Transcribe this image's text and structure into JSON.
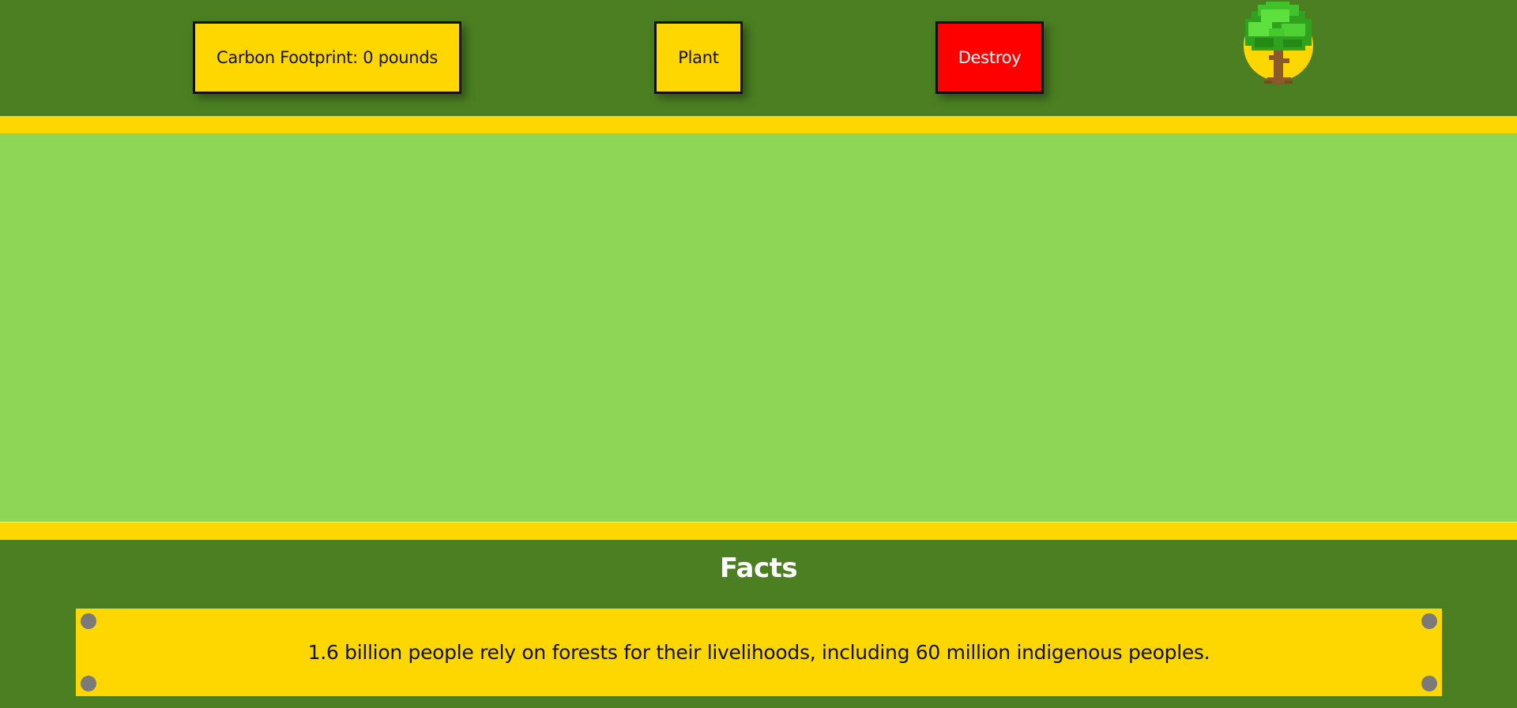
{
  "header": {
    "carbon_footprint_label": "Carbon Footprint: 0 pounds",
    "plant_label": "Plant",
    "destroy_label": "Destroy",
    "logo_icon": "tree-icon"
  },
  "facts": {
    "title": "Facts",
    "current_fact": "1.6 billion people rely on forests for their livelihoods, including 60 million indigenous peoples."
  },
  "colors": {
    "background": "#4b7f22",
    "field": "#8ed656",
    "accent_yellow": "#ffd700",
    "destroy_red": "#ff0000"
  }
}
